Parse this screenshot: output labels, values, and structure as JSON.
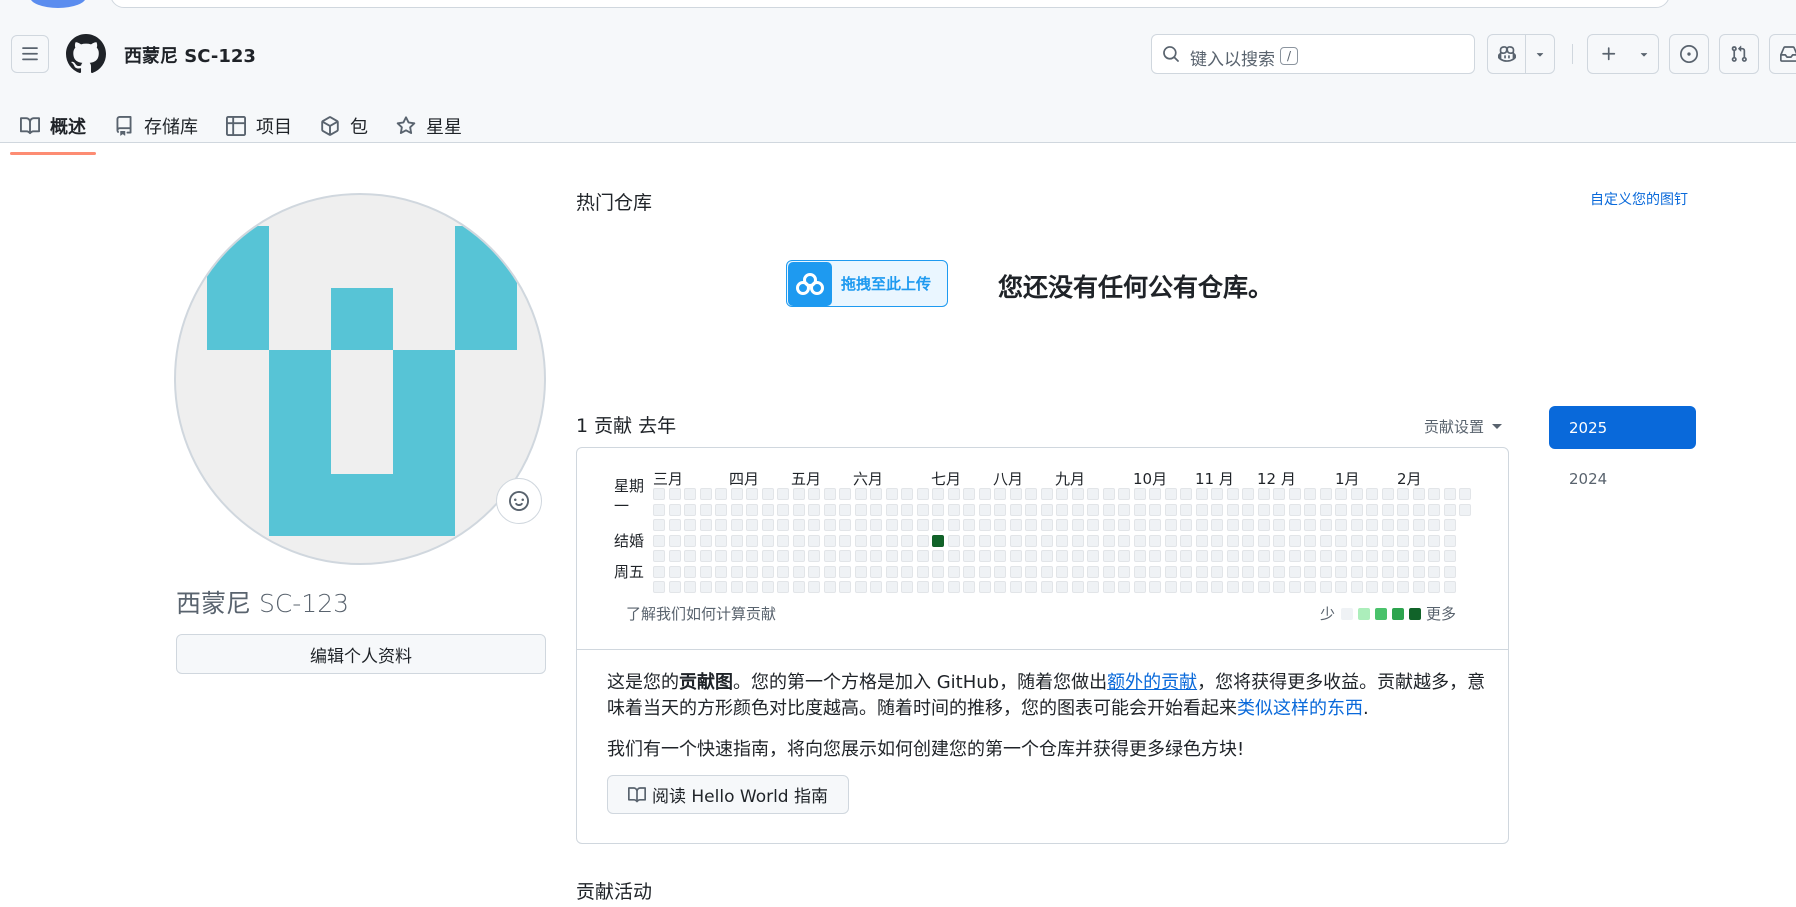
{
  "header": {
    "username": "西蒙尼 SC-123",
    "search_placeholder": "键入以搜索",
    "search_shortcut": "/"
  },
  "tabs": [
    {
      "label": "概述",
      "icon": "book-icon",
      "active": true
    },
    {
      "label": "存储库",
      "icon": "repo-icon",
      "active": false
    },
    {
      "label": "项目",
      "icon": "table-icon",
      "active": false
    },
    {
      "label": "包",
      "icon": "package-icon",
      "active": false
    },
    {
      "label": "星星",
      "icon": "star-icon",
      "active": false
    }
  ],
  "profile": {
    "display_name": "西蒙尼 SC-123",
    "edit_button": "编辑个人资料",
    "avatar_color": "#57c4d6"
  },
  "pinned": {
    "title": "热门仓库",
    "customize_link": "自定义您的图钉",
    "upload_badge": "拖拽至此上传",
    "empty_message": "您还没有任何公有仓库。"
  },
  "contributions": {
    "count_text": "1 贡献 去年",
    "settings_label": "贡献设置",
    "months": [
      "三月",
      "四月",
      "五月",
      "六月",
      "七月",
      "八月",
      "九月",
      "10月",
      "11 月",
      "12 月",
      "1月",
      "2月"
    ],
    "day_labels": [
      "星期一",
      "结婚",
      "周五"
    ],
    "learn_link": "了解我们如何计算贡献",
    "legend_less": "少",
    "legend_more": "更多",
    "legend_colors": [
      "#eff2f5",
      "#aceebb",
      "#4ac26b",
      "#2da44e",
      "#116329"
    ],
    "active_cell": {
      "week": 18,
      "day": 3,
      "color": "#116329"
    },
    "years": [
      "2025",
      "2024"
    ],
    "selected_year": "2025"
  },
  "graph_text": {
    "p1_a": "这是您的",
    "p1_b": "贡献图",
    "p1_c": "。您的第一个方格是加入 GitHub，随着您做出",
    "p1_link1": "额外的贡献",
    "p1_d": "，您将获得更多收益。贡献越多，意味着当天的方形颜色对比度越高。随着时间的推移，您的图表可能会开始看起来",
    "p1_link2": "类似这样的东西",
    "p1_e": ".",
    "p2": "我们有一个快速指南，将向您展示如何创建您的第一个仓库并获得更多绿色方块!",
    "guide_button": "阅读 Hello World 指南"
  },
  "activity": {
    "title": "贡献活动"
  }
}
